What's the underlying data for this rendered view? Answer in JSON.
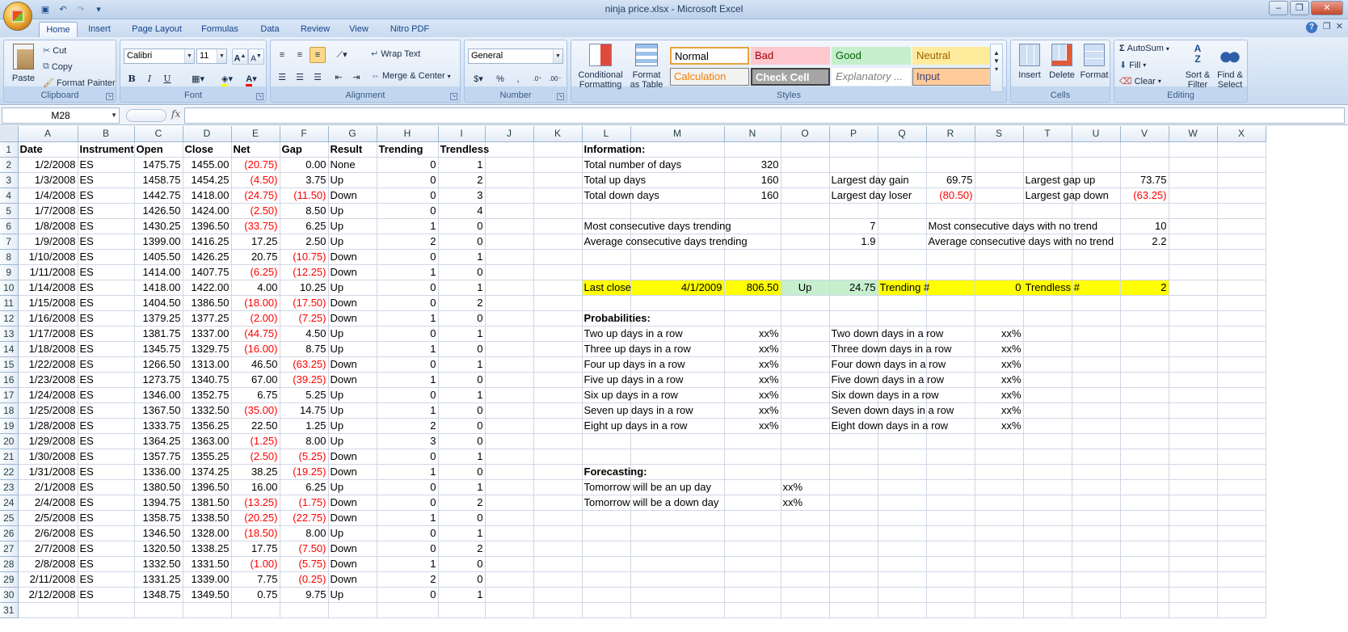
{
  "window": {
    "title": "ninja price.xlsx - Microsoft Excel"
  },
  "tabs": [
    "Home",
    "Insert",
    "Page Layout",
    "Formulas",
    "Data",
    "Review",
    "View",
    "Nitro PDF"
  ],
  "clipboard": {
    "paste": "Paste",
    "cut": "Cut",
    "copy": "Copy",
    "format_painter": "Format Painter",
    "label": "Clipboard"
  },
  "font": {
    "name": "Calibri",
    "size": "11",
    "label": "Font",
    "bold": "B",
    "italic": "I",
    "underline": "U"
  },
  "alignment": {
    "wrap_text": "Wrap Text",
    "merge_center": "Merge & Center",
    "label": "Alignment"
  },
  "number": {
    "format": "General",
    "label": "Number",
    "currency": "$",
    "percent": "%",
    "comma": ","
  },
  "styles": {
    "conditional": "Conditional Formatting",
    "format_table": "Format as Table",
    "label": "Styles",
    "cells": [
      {
        "name": "Normal",
        "bg": "#ffffff",
        "fg": "#000000",
        "border": "#e6a33c"
      },
      {
        "name": "Bad",
        "bg": "#ffc7ce",
        "fg": "#9c0006"
      },
      {
        "name": "Good",
        "bg": "#c6efce",
        "fg": "#006100"
      },
      {
        "name": "Neutral",
        "bg": "#ffeb9c",
        "fg": "#9c6500"
      },
      {
        "name": "Calculation",
        "bg": "#f2f2f2",
        "fg": "#fa7d00"
      },
      {
        "name": "Check Cell",
        "bg": "#a5a5a5",
        "fg": "#ffffff"
      },
      {
        "name": "Explanatory ...",
        "bg": "#ffffff",
        "fg": "#7f7f7f"
      },
      {
        "name": "Input",
        "bg": "#ffcc99",
        "fg": "#3f3f76"
      }
    ]
  },
  "cells_group": {
    "insert": "Insert",
    "delete": "Delete",
    "format": "Format",
    "label": "Cells"
  },
  "editing": {
    "autosum": "AutoSum",
    "fill": "Fill",
    "clear": "Clear",
    "sort_filter": "Sort & Filter",
    "find_select": "Find & Select",
    "label": "Editing"
  },
  "formula_bar": {
    "name_box": "M28",
    "fx": "fx",
    "content": ""
  },
  "columns": [
    "A",
    "B",
    "C",
    "D",
    "E",
    "F",
    "G",
    "H",
    "I",
    "J",
    "K",
    "L",
    "M",
    "N",
    "O",
    "P",
    "Q",
    "R",
    "S",
    "T",
    "U",
    "V",
    "W",
    "X"
  ],
  "headers": [
    "Date",
    "Instrument",
    "Open",
    "Close",
    "Net",
    "Gap",
    "Result",
    "Trending",
    "Trendless"
  ],
  "rows": [
    [
      "1/2/2008",
      "ES",
      "1475.75",
      "1455.00",
      "(20.75)",
      "0.00",
      "None",
      "0",
      "1"
    ],
    [
      "1/3/2008",
      "ES",
      "1458.75",
      "1454.25",
      "(4.50)",
      "3.75",
      "Up",
      "0",
      "2"
    ],
    [
      "1/4/2008",
      "ES",
      "1442.75",
      "1418.00",
      "(24.75)",
      "(11.50)",
      "Down",
      "0",
      "3"
    ],
    [
      "1/7/2008",
      "ES",
      "1426.50",
      "1424.00",
      "(2.50)",
      "8.50",
      "Up",
      "0",
      "4"
    ],
    [
      "1/8/2008",
      "ES",
      "1430.25",
      "1396.50",
      "(33.75)",
      "6.25",
      "Up",
      "1",
      "0"
    ],
    [
      "1/9/2008",
      "ES",
      "1399.00",
      "1416.25",
      "17.25",
      "2.50",
      "Up",
      "2",
      "0"
    ],
    [
      "1/10/2008",
      "ES",
      "1405.50",
      "1426.25",
      "20.75",
      "(10.75)",
      "Down",
      "0",
      "1"
    ],
    [
      "1/11/2008",
      "ES",
      "1414.00",
      "1407.75",
      "(6.25)",
      "(12.25)",
      "Down",
      "1",
      "0"
    ],
    [
      "1/14/2008",
      "ES",
      "1418.00",
      "1422.00",
      "4.00",
      "10.25",
      "Up",
      "0",
      "1"
    ],
    [
      "1/15/2008",
      "ES",
      "1404.50",
      "1386.50",
      "(18.00)",
      "(17.50)",
      "Down",
      "0",
      "2"
    ],
    [
      "1/16/2008",
      "ES",
      "1379.25",
      "1377.25",
      "(2.00)",
      "(7.25)",
      "Down",
      "1",
      "0"
    ],
    [
      "1/17/2008",
      "ES",
      "1381.75",
      "1337.00",
      "(44.75)",
      "4.50",
      "Up",
      "0",
      "1"
    ],
    [
      "1/18/2008",
      "ES",
      "1345.75",
      "1329.75",
      "(16.00)",
      "8.75",
      "Up",
      "1",
      "0"
    ],
    [
      "1/22/2008",
      "ES",
      "1266.50",
      "1313.00",
      "46.50",
      "(63.25)",
      "Down",
      "0",
      "1"
    ],
    [
      "1/23/2008",
      "ES",
      "1273.75",
      "1340.75",
      "67.00",
      "(39.25)",
      "Down",
      "1",
      "0"
    ],
    [
      "1/24/2008",
      "ES",
      "1346.00",
      "1352.75",
      "6.75",
      "5.25",
      "Up",
      "0",
      "1"
    ],
    [
      "1/25/2008",
      "ES",
      "1367.50",
      "1332.50",
      "(35.00)",
      "14.75",
      "Up",
      "1",
      "0"
    ],
    [
      "1/28/2008",
      "ES",
      "1333.75",
      "1356.25",
      "22.50",
      "1.25",
      "Up",
      "2",
      "0"
    ],
    [
      "1/29/2008",
      "ES",
      "1364.25",
      "1363.00",
      "(1.25)",
      "8.00",
      "Up",
      "3",
      "0"
    ],
    [
      "1/30/2008",
      "ES",
      "1357.75",
      "1355.25",
      "(2.50)",
      "(5.25)",
      "Down",
      "0",
      "1"
    ],
    [
      "1/31/2008",
      "ES",
      "1336.00",
      "1374.25",
      "38.25",
      "(19.25)",
      "Down",
      "1",
      "0"
    ],
    [
      "2/1/2008",
      "ES",
      "1380.50",
      "1396.50",
      "16.00",
      "6.25",
      "Up",
      "0",
      "1"
    ],
    [
      "2/4/2008",
      "ES",
      "1394.75",
      "1381.50",
      "(13.25)",
      "(1.75)",
      "Down",
      "0",
      "2"
    ],
    [
      "2/5/2008",
      "ES",
      "1358.75",
      "1338.50",
      "(20.25)",
      "(22.75)",
      "Down",
      "1",
      "0"
    ],
    [
      "2/6/2008",
      "ES",
      "1346.50",
      "1328.00",
      "(18.50)",
      "8.00",
      "Up",
      "0",
      "1"
    ],
    [
      "2/7/2008",
      "ES",
      "1320.50",
      "1338.25",
      "17.75",
      "(7.50)",
      "Down",
      "0",
      "2"
    ],
    [
      "2/8/2008",
      "ES",
      "1332.50",
      "1331.50",
      "(1.00)",
      "(5.75)",
      "Down",
      "1",
      "0"
    ],
    [
      "2/11/2008",
      "ES",
      "1331.25",
      "1339.00",
      "7.75",
      "(0.25)",
      "Down",
      "2",
      "0"
    ],
    [
      "2/12/2008",
      "ES",
      "1348.75",
      "1349.50",
      "0.75",
      "9.75",
      "Up",
      "0",
      "1"
    ]
  ],
  "info": {
    "information": "Information:",
    "total_days_label": "Total number of days",
    "total_days": "320",
    "up_days_label": "Total up days",
    "up_days": "160",
    "down_days_label": "Total down days",
    "down_days": "160",
    "largest_gain_label": "Largest day gain",
    "largest_gain": "69.75",
    "largest_loser_label": "Largest day loser",
    "largest_loser": "(80.50)",
    "largest_gap_up_label": "Largest gap up",
    "largest_gap_up": "73.75",
    "largest_gap_down_label": "Largest gap down",
    "largest_gap_down": "(63.25)",
    "most_trend_label": "Most consecutive days trending",
    "most_trend": "7",
    "avg_trend_label": "Average consecutive days trending",
    "avg_trend": "1.9",
    "most_notrend_label": "Most consecutive days with no trend",
    "most_notrend": "10",
    "avg_notrend_label": "Average consecutive days with no trend",
    "avg_notrend": "2.2",
    "last_close_label": "Last close",
    "last_close_date": "4/1/2009",
    "last_close": "806.50",
    "last_dir": "Up",
    "last_net": "24.75",
    "trending_label": "Trending #",
    "trending": "0",
    "trendless_label": "Trendless #",
    "trendless": "2",
    "probabilities": "Probabilities:",
    "prob_up": [
      "Two up days in a row",
      "Three up days in a row",
      "Four up days in a row",
      "Five up days in a row",
      "Six up days in a row",
      "Seven up days in a row",
      "Eight up days in a row"
    ],
    "prob_down": [
      "Two down days in a row",
      "Three down days in a row",
      "Four down days in a row",
      "Five down days in a row",
      "Six down days in a row",
      "Seven down days in a row",
      "Eight down days in a row"
    ],
    "pct": "xx%",
    "forecasting": "Forecasting:",
    "forecast_up": "Tomorrow will be an up day",
    "forecast_down": "Tomorrow will be a down day"
  }
}
